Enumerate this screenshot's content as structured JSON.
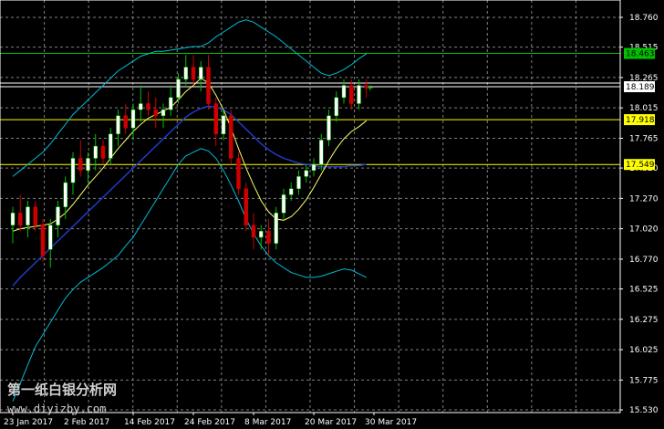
{
  "chart_data": {
    "type": "candlestick",
    "title": "",
    "background": "#000000",
    "colors": {
      "grid": "#7f7f7f",
      "up": "#ffffff",
      "down": "#cc0000",
      "bb": "#00bcd4",
      "ma_fast": "#ffff66",
      "ma_slow": "#1e3fd6",
      "level_green": "#00c000",
      "level_yellow": "#ffff00"
    },
    "ylim": [
      15.53,
      18.76
    ],
    "y_ticks": [
      18.76,
      18.515,
      18.265,
      18.015,
      17.765,
      17.52,
      17.27,
      17.02,
      16.77,
      16.525,
      16.275,
      16.025,
      15.775,
      15.53
    ],
    "y_tick_labels": [
      "18.760",
      "18.515",
      "18.265",
      "18.015",
      "17.765",
      "17.520",
      "17.270",
      "17.020",
      "16.770",
      "16.525",
      "16.275",
      "16.025",
      "15.775",
      "15.530"
    ],
    "x_tick_labels": [
      "23 Jan 2017",
      "2 Feb 2017",
      "14 Feb 2017",
      "24 Feb 2017",
      "8 Mar 2017",
      "20 Mar 2017",
      "30 Mar 2017"
    ],
    "x_tick_index": [
      0,
      8,
      16,
      24,
      32,
      40,
      48
    ],
    "levels": [
      {
        "price": 18.463,
        "label": "18.463",
        "color": "green"
      },
      {
        "price": 18.189,
        "label": "18.189",
        "color": "white"
      },
      {
        "price": 17.918,
        "label": "17.918",
        "color": "yellow"
      },
      {
        "price": 17.549,
        "label": "17.549",
        "color": "yellow"
      }
    ],
    "candles": [
      [
        17.05,
        17.2,
        16.9,
        17.15
      ],
      [
        17.15,
        17.3,
        17.0,
        17.05
      ],
      [
        17.05,
        17.25,
        16.95,
        17.2
      ],
      [
        17.2,
        17.25,
        17.0,
        17.05
      ],
      [
        17.05,
        17.1,
        16.75,
        16.8
      ],
      [
        16.85,
        17.1,
        16.7,
        17.05
      ],
      [
        17.05,
        17.25,
        16.95,
        17.2
      ],
      [
        17.2,
        17.45,
        17.1,
        17.4
      ],
      [
        17.4,
        17.65,
        17.3,
        17.6
      ],
      [
        17.6,
        17.75,
        17.45,
        17.5
      ],
      [
        17.5,
        17.65,
        17.4,
        17.6
      ],
      [
        17.6,
        17.8,
        17.5,
        17.7
      ],
      [
        17.7,
        17.75,
        17.55,
        17.6
      ],
      [
        17.6,
        17.85,
        17.55,
        17.8
      ],
      [
        17.8,
        18.0,
        17.7,
        17.95
      ],
      [
        17.95,
        18.05,
        17.8,
        17.85
      ],
      [
        17.85,
        18.05,
        17.75,
        18.0
      ],
      [
        18.0,
        18.2,
        17.9,
        18.05
      ],
      [
        18.05,
        18.15,
        17.95,
        18.0
      ],
      [
        18.0,
        18.1,
        17.85,
        17.95
      ],
      [
        17.95,
        18.05,
        17.85,
        18.0
      ],
      [
        18.0,
        18.2,
        17.95,
        18.1
      ],
      [
        18.1,
        18.3,
        18.05,
        18.25
      ],
      [
        18.25,
        18.45,
        18.2,
        18.35
      ],
      [
        18.35,
        18.45,
        18.2,
        18.25
      ],
      [
        18.25,
        18.4,
        18.15,
        18.35
      ],
      [
        18.35,
        18.45,
        18.0,
        18.05
      ],
      [
        18.05,
        18.1,
        17.7,
        17.8
      ],
      [
        17.8,
        18.0,
        17.75,
        17.95
      ],
      [
        17.95,
        18.0,
        17.55,
        17.6
      ],
      [
        17.6,
        17.65,
        17.3,
        17.35
      ],
      [
        17.35,
        17.4,
        17.0,
        17.05
      ],
      [
        17.05,
        17.15,
        16.85,
        16.95
      ],
      [
        16.95,
        17.05,
        16.85,
        17.0
      ],
      [
        17.0,
        17.1,
        16.8,
        16.9
      ],
      [
        16.9,
        17.2,
        16.85,
        17.15
      ],
      [
        17.15,
        17.35,
        17.1,
        17.3
      ],
      [
        17.3,
        17.4,
        17.25,
        17.35
      ],
      [
        17.35,
        17.5,
        17.3,
        17.45
      ],
      [
        17.45,
        17.55,
        17.4,
        17.5
      ],
      [
        17.5,
        17.6,
        17.45,
        17.55
      ],
      [
        17.55,
        17.8,
        17.5,
        17.75
      ],
      [
        17.75,
        18.0,
        17.7,
        17.95
      ],
      [
        17.95,
        18.15,
        17.9,
        18.1
      ],
      [
        18.1,
        18.25,
        18.05,
        18.2
      ],
      [
        18.2,
        18.25,
        18.0,
        18.05
      ],
      [
        18.05,
        18.25,
        18.0,
        18.2
      ],
      [
        18.2,
        18.25,
        18.1,
        18.18
      ]
    ],
    "bb_upper": [
      17.45,
      17.5,
      17.55,
      17.6,
      17.65,
      17.72,
      17.8,
      17.88,
      17.96,
      18.02,
      18.08,
      18.14,
      18.2,
      18.26,
      18.32,
      18.36,
      18.4,
      18.44,
      18.46,
      18.48,
      18.48,
      18.49,
      18.5,
      18.51,
      18.52,
      18.52,
      18.55,
      18.6,
      18.64,
      18.68,
      18.72,
      18.74,
      18.72,
      18.68,
      18.64,
      18.6,
      18.55,
      18.5,
      18.45,
      18.4,
      18.35,
      18.3,
      18.28,
      18.3,
      18.33,
      18.37,
      18.42,
      18.46
    ],
    "bb_lower": [
      15.6,
      15.75,
      15.9,
      16.05,
      16.15,
      16.25,
      16.35,
      16.45,
      16.52,
      16.58,
      16.62,
      16.66,
      16.7,
      16.75,
      16.8,
      16.88,
      16.95,
      17.05,
      17.15,
      17.25,
      17.35,
      17.45,
      17.55,
      17.62,
      17.65,
      17.68,
      17.66,
      17.6,
      17.5,
      17.38,
      17.25,
      17.1,
      16.98,
      16.88,
      16.8,
      16.74,
      16.7,
      16.66,
      16.64,
      16.62,
      16.62,
      16.63,
      16.65,
      16.67,
      16.69,
      16.68,
      16.65,
      16.62
    ],
    "ma_fast": [
      17.0,
      17.02,
      17.03,
      17.04,
      17.05,
      17.06,
      17.1,
      17.15,
      17.22,
      17.3,
      17.38,
      17.45,
      17.52,
      17.6,
      17.68,
      17.75,
      17.82,
      17.88,
      17.93,
      17.96,
      17.99,
      18.02,
      18.08,
      18.15,
      18.2,
      18.26,
      18.22,
      18.12,
      18.0,
      17.85,
      17.68,
      17.52,
      17.38,
      17.25,
      17.16,
      17.1,
      17.09,
      17.12,
      17.18,
      17.26,
      17.36,
      17.47,
      17.58,
      17.68,
      17.76,
      17.82,
      17.86,
      17.91
    ],
    "ma_slow": [
      16.55,
      16.62,
      16.68,
      16.74,
      16.8,
      16.86,
      16.92,
      16.98,
      17.04,
      17.1,
      17.16,
      17.22,
      17.28,
      17.34,
      17.4,
      17.46,
      17.52,
      17.58,
      17.64,
      17.7,
      17.76,
      17.82,
      17.88,
      17.94,
      17.98,
      18.01,
      18.03,
      18.02,
      18.0,
      17.96,
      17.9,
      17.84,
      17.78,
      17.72,
      17.67,
      17.63,
      17.6,
      17.58,
      17.56,
      17.55,
      17.54,
      17.53,
      17.53,
      17.53,
      17.53,
      17.54,
      17.54,
      17.55
    ]
  },
  "watermark": {
    "line1": "第一纸白银分析网",
    "line2": "www.diyizby.com"
  }
}
